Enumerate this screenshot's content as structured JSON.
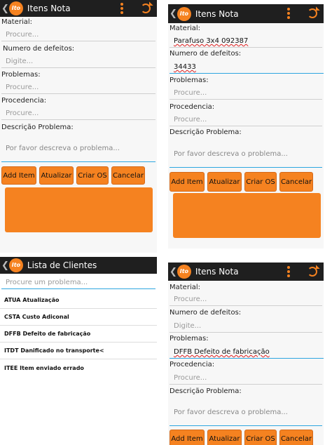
{
  "panels": {
    "tl": {
      "title": "Itens Nota",
      "back": "❮",
      "logo": "Ito",
      "labels": {
        "material": "Material:",
        "defeitos": "Numero de defeitos:",
        "problemas": "Problemas:",
        "procedencia": "Procedencia:",
        "descricao": "Descrição Problema:"
      },
      "fields": {
        "material": "Procure...",
        "defeitos": "Digite...",
        "problemas": "Procure...",
        "procedencia": "Procure..."
      },
      "description_placeholder": "Por favor descreva o problema...",
      "buttons": {
        "add": "Add Item",
        "update": "Atualizar",
        "create": "Criar OS",
        "cancel": "Cancelar"
      }
    },
    "tr": {
      "title": "Itens Nota",
      "back": "❮",
      "logo": "Ito",
      "labels": {
        "material": "Material:",
        "defeitos": "Numero de defeitos:",
        "problemas": "Problemas:",
        "procedencia": "Procedencia:",
        "descricao": "Descrição Problema:"
      },
      "fields": {
        "material": "Parafuso 3x4 092387",
        "defeitos": "34433",
        "problemas": "Procure...",
        "procedencia": "Procure..."
      },
      "description_placeholder": "Por favor descreva o problema...",
      "buttons": {
        "add": "Add Item",
        "update": "Atualizar",
        "create": "Criar OS",
        "cancel": "Cancelar"
      }
    },
    "bl": {
      "title": "Lista de Clientes",
      "back": "❮",
      "logo": "Ito",
      "search_placeholder": "Procure um problema...",
      "items": [
        "ATUA Atualização",
        "CSTA Custo Adiconal",
        "DFFB Defeito de fabricação",
        "ITDT Danificado no transporte<",
        "ITEE Item enviado errado"
      ]
    },
    "br": {
      "title": "Itens Nota",
      "back": "❮",
      "logo": "Ito",
      "labels": {
        "material": "Material:",
        "defeitos": "Numero de defeitos:",
        "problemas": "Problemas:",
        "procedencia": "Procedencia:",
        "descricao": "Descrição Problema:"
      },
      "fields": {
        "material": "Procure...",
        "defeitos": "Digite...",
        "problemas": "DFFB Defeito de fabricação",
        "procedencia": "Procure..."
      },
      "description_placeholder": "Por favor descreva o problema...",
      "buttons": {
        "add": "Add Item",
        "update": "Atualizar",
        "create": "Criar OS",
        "cancel": "Cancelar"
      }
    }
  },
  "colors": {
    "accent": "#f58220",
    "actionbar": "#1f1f1f",
    "focus": "#2ea6e0"
  }
}
